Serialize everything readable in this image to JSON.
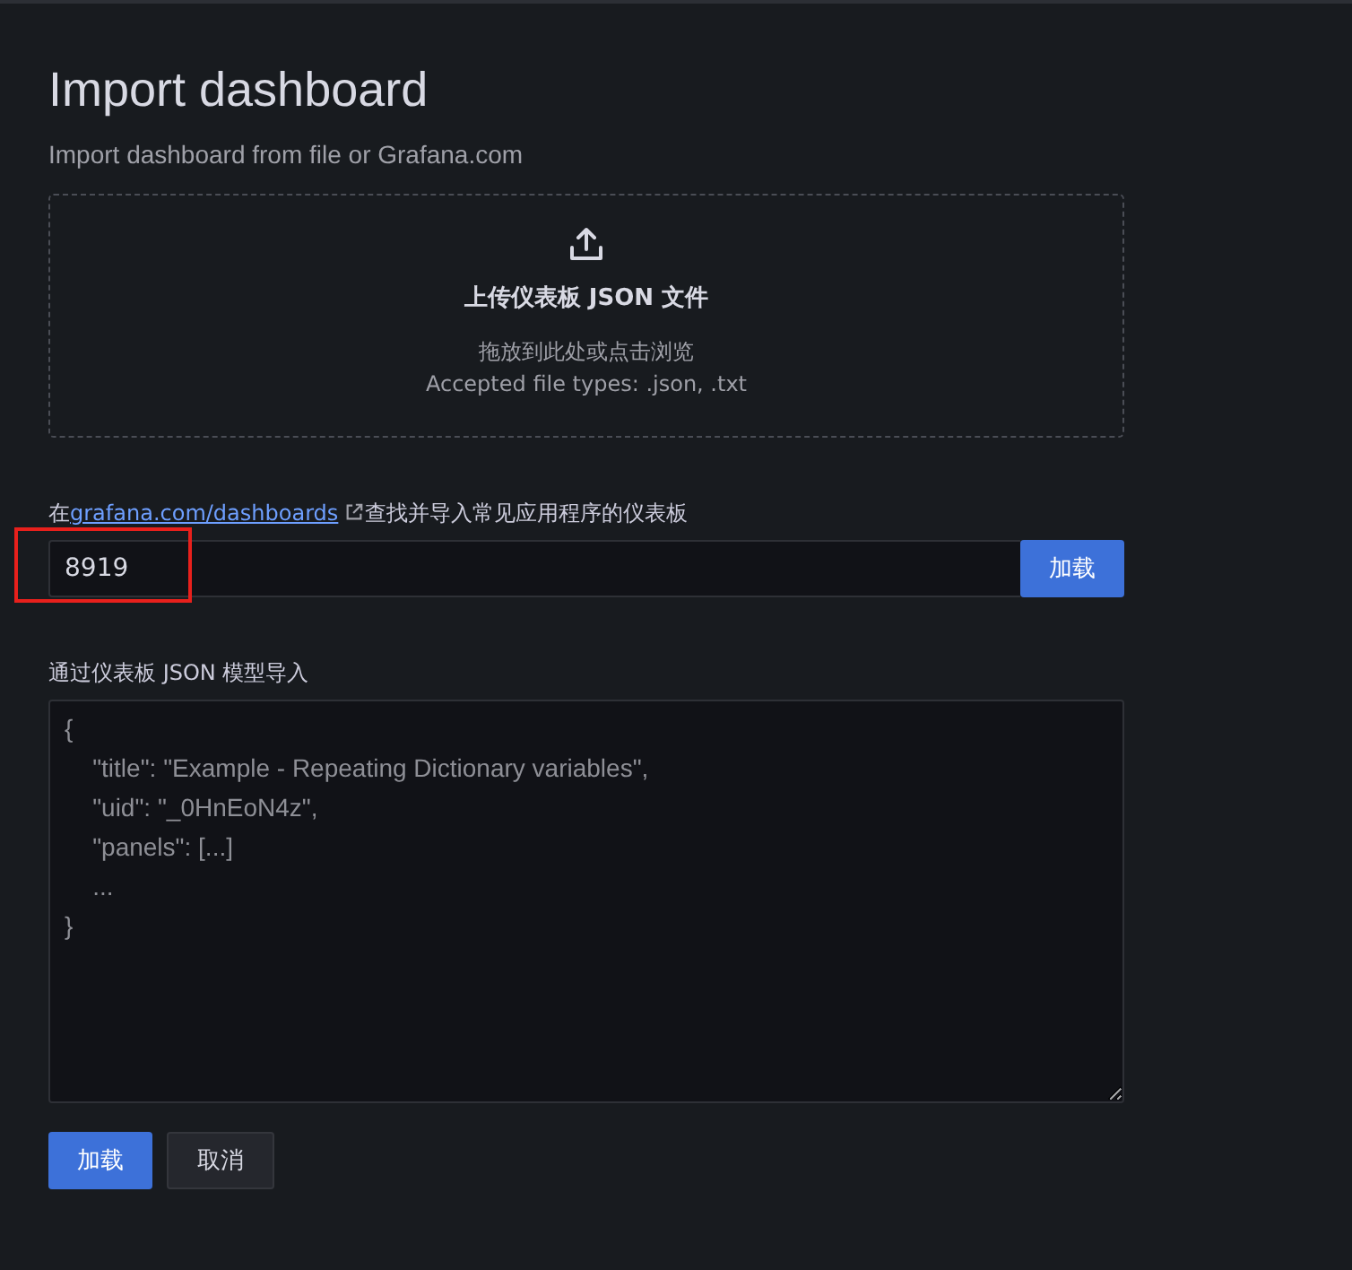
{
  "page": {
    "title": "Import dashboard",
    "subtitle": "Import dashboard from file or Grafana.com"
  },
  "upload": {
    "title": "上传仪表板 JSON 文件",
    "hint": "拖放到此处或点击浏览",
    "accepted": "Accepted file types: .json, .txt"
  },
  "grafana_import": {
    "prefix": "在",
    "link": "grafana.com/dashboards",
    "suffix": "查找并导入常见应用程序的仪表板",
    "value": "8919",
    "button": "加载",
    "highlighted": true
  },
  "json_import": {
    "label": "通过仪表板 JSON 模型导入",
    "placeholder": "{\n    \"title\": \"Example - Repeating Dictionary variables\",\n    \"uid\": \"_0HnEoN4z\",\n    \"panels\": [...]\n    ...\n}"
  },
  "buttons": [
    {
      "label": "加载",
      "kind": "primary"
    },
    {
      "label": "取消",
      "kind": "secondary"
    }
  ]
}
